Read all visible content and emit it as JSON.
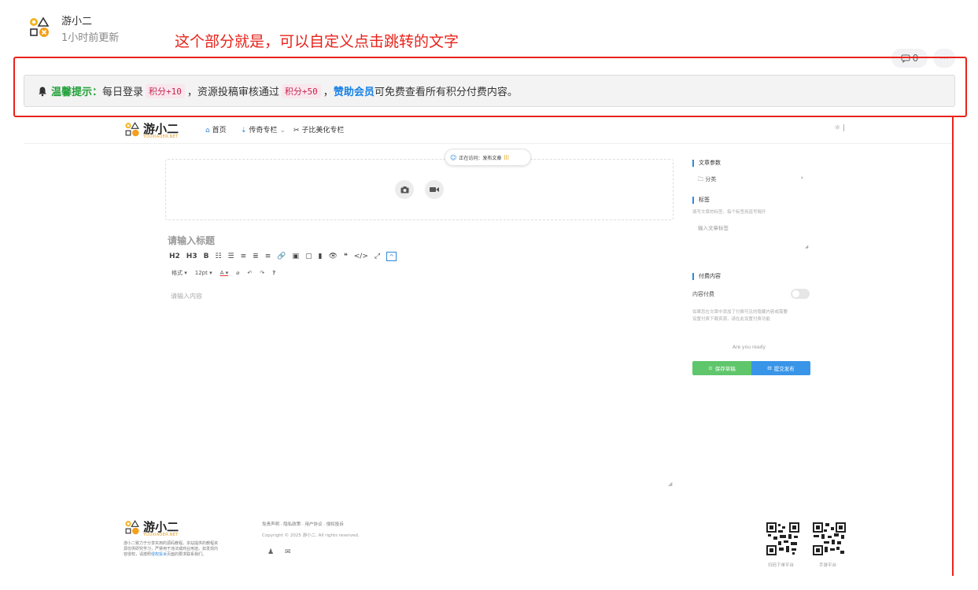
{
  "post": {
    "author": "游小二",
    "updated": "1小时前更新",
    "comment_count": "0",
    "more": "···"
  },
  "annotation": "这个部分就是，可以自定义点击跳转的文字",
  "notice": {
    "label": "温馨提示：",
    "t1": "每日登录",
    "code1": "积分+10",
    "t2": "，资源投稿审核通过",
    "code2": "积分+50",
    "t3": "，",
    "link": "赞助会员",
    "t4": "可免费查看所有积分付费内容。"
  },
  "site": {
    "logo_name": "游小二",
    "logo_sub": "YOUXIAOER.NET",
    "nav": [
      "首页",
      "传奇专栏",
      "子比美化专栏"
    ],
    "nav_caret": "⌄"
  },
  "editor": {
    "status_chip": "正在访问：发布文章",
    "status_bars": "|||",
    "title_placeholder": "请输入标题",
    "toolbar1": [
      "H2",
      "H3",
      "B",
      "☷",
      "☰",
      "≡",
      "≣",
      "≡",
      "🔗",
      "▣",
      "▢",
      "▮",
      "👁",
      "❝",
      "</>",
      "⤢"
    ],
    "toolbar2": [
      "格式 ▾",
      "12pt ▾",
      "A ▾",
      "⌀",
      "↶",
      "↷",
      "?"
    ],
    "content_placeholder": "请输入内容"
  },
  "sidebar": {
    "params_title": "文章参数",
    "category": "分类",
    "category_arrow": "›",
    "tags_title": "标签",
    "tags_hint": "填写文章的标签，每个标签用逗号隔开",
    "tags_placeholder": "输入文章标签",
    "paid_title": "付费内容",
    "paid_toggle_label": "内容付费",
    "paid_hint_1": "如果您在文章中添加了付费可见的隐藏内容或需要",
    "paid_hint_2": "设置付费下载资源，请在此设置付费功能",
    "ready": "Are you ready",
    "save_btn": "保存草稿",
    "publish_btn": "提交发布"
  },
  "footer": {
    "desc_1": "游小二致力于分享实用的源码教程，本站提供的教程资",
    "desc_2": "源仅供研究学习，严禁用于违法或商业用途。如发现内",
    "desc_3": "容侵权，请按照",
    "desc_link": "侵权投诉",
    "desc_4": "页面的要求联系我们。",
    "links": "免责声明 · 隐私政策 · 用户协议 · 侵权投诉",
    "copyright": "Copyright © 2025 游小二. All rights reserved.",
    "qr1_label": "扫码下单平台",
    "qr2_label": "手游平台"
  },
  "colors": {
    "annotation_red": "#e8231b",
    "tip_green": "#22a13a",
    "link_blue": "#1680e6",
    "save_green": "#5fc66b",
    "publish_blue": "#3895e8"
  }
}
